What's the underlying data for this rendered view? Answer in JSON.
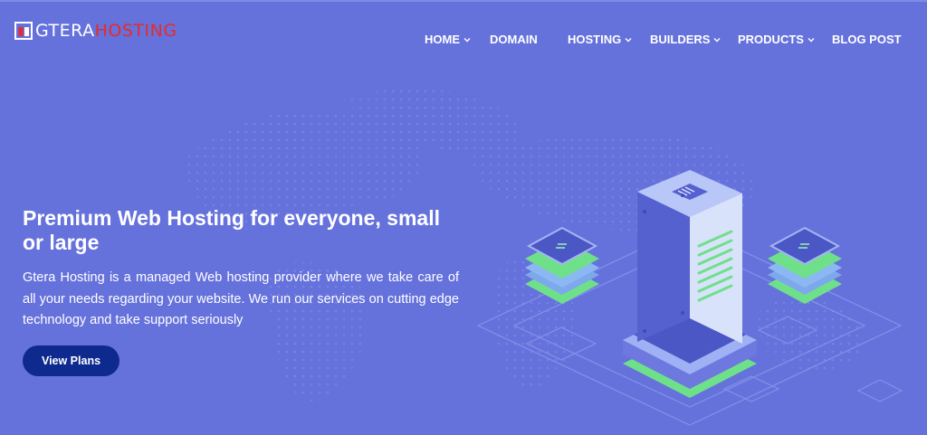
{
  "brand": {
    "name_primary": "GTERA",
    "name_accent": "HOSTING",
    "accent_color": "#e52b2b"
  },
  "nav": {
    "items": [
      {
        "label": "HOME",
        "has_dropdown": true
      },
      {
        "label": "DOMAIN",
        "has_dropdown": false
      },
      {
        "label": "HOSTING",
        "has_dropdown": true
      },
      {
        "label": "BUILDERS",
        "has_dropdown": true
      },
      {
        "label": "PRODUCTS",
        "has_dropdown": true
      },
      {
        "label": "BLOG POST",
        "has_dropdown": false
      }
    ]
  },
  "hero": {
    "title": "Premium Web Hosting for everyone, small or large",
    "description": "Gtera Hosting is a managed Web hosting provider where we take care of all your needs regarding your website. We run our services on cutting edge technology and take support seriously",
    "cta_label": "View Plans"
  },
  "colors": {
    "background": "#6672dc",
    "button": "#0e2a8f",
    "server_green": "#6fe08a"
  }
}
